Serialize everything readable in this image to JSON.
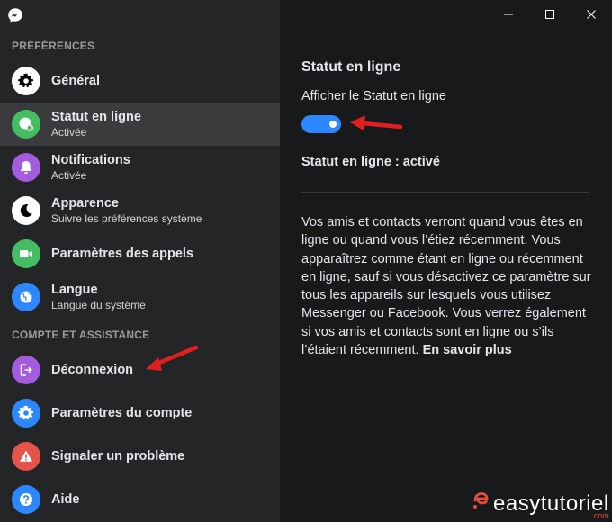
{
  "sidebar": {
    "section_preferences": "PRÉFÉRENCES",
    "section_account": "COMPTE ET ASSISTANCE",
    "items": [
      {
        "title": "Général",
        "subtitle": ""
      },
      {
        "title": "Statut en ligne",
        "subtitle": "Activée"
      },
      {
        "title": "Notifications",
        "subtitle": "Activée"
      },
      {
        "title": "Apparence",
        "subtitle": "Suivre les préférences système"
      },
      {
        "title": "Paramètres des appels",
        "subtitle": ""
      },
      {
        "title": "Langue",
        "subtitle": "Langue du système"
      },
      {
        "title": "Déconnexion",
        "subtitle": ""
      },
      {
        "title": "Paramètres du compte",
        "subtitle": ""
      },
      {
        "title": "Signaler un problème",
        "subtitle": ""
      },
      {
        "title": "Aide",
        "subtitle": ""
      }
    ],
    "active_item": "Statut en ligne"
  },
  "main": {
    "title": "Statut en ligne",
    "toggle_label": "Afficher le Statut en ligne",
    "toggle_on": true,
    "status_text": "Statut en ligne : activé",
    "description": "Vos amis et contacts verront quand vous êtes en ligne ou quand vous l’étiez récemment. Vous apparaîtrez comme étant en ligne ou récemment en ligne, sauf si vous désactivez ce paramètre sur tous les appareils sur lesquels vous utilisez Messenger ou Facebook. Vous verrez également si vos amis et contacts sont en ligne ou s’ils l’étaient récemment.",
    "learn_more": "En savoir plus"
  },
  "watermark": {
    "text": "easytutoriel",
    "suffix": ".com"
  },
  "colors": {
    "sidebar_bg": "#242526",
    "main_bg": "#18191a",
    "active_bg": "#3a3b3c",
    "accent_blue": "#2d88ff",
    "online_green": "#45bd62",
    "purple": "#a35cde",
    "red": "#e4544a",
    "annotation_red": "#e02020"
  },
  "icons": {
    "app": "messenger-icon",
    "items": [
      "gear-icon",
      "online-status-icon",
      "bell-icon",
      "moon-icon",
      "video-camera-icon",
      "globe-icon",
      "logout-icon",
      "gear-icon",
      "warning-icon",
      "question-icon"
    ],
    "window": [
      "minimize-icon",
      "maximize-icon",
      "close-icon"
    ]
  }
}
